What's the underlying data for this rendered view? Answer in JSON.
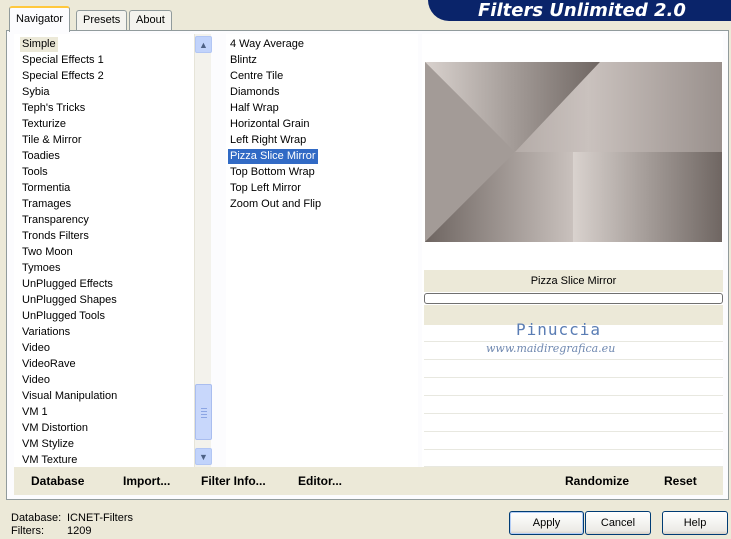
{
  "tabs": [
    {
      "label": "Navigator",
      "active": true
    },
    {
      "label": "Presets",
      "active": false
    },
    {
      "label": "About",
      "active": false
    }
  ],
  "banner": {
    "title": "Filters Unlimited 2.0"
  },
  "categories": {
    "selected": "Simple",
    "items": [
      "Simple",
      "Special Effects 1",
      "Special Effects 2",
      "Sybia",
      "Teph's Tricks",
      "Texturize",
      "Tile & Mirror",
      "Toadies",
      "Tools",
      "Tormentia",
      "Tramages",
      "Transparency",
      "Tronds Filters",
      "Two Moon",
      "Tymoes",
      "UnPlugged Effects",
      "UnPlugged Shapes",
      "UnPlugged Tools",
      "Variations",
      "Video",
      "VideoRave",
      "Video",
      "Visual Manipulation",
      "VM 1",
      "VM Distortion",
      "VM Stylize",
      "VM Texture"
    ]
  },
  "filters": {
    "selected": "Pizza Slice Mirror",
    "items": [
      "4 Way Average",
      "Blintz",
      "Centre Tile",
      "Diamonds",
      "Half Wrap",
      "Horizontal Grain",
      "Left Right Wrap",
      "Pizza Slice Mirror",
      "Top Bottom Wrap",
      "Top Left Mirror",
      "Zoom Out and Flip"
    ]
  },
  "preview": {
    "filter_name": "Pizza Slice Mirror"
  },
  "watermark": {
    "name": "Pinuccia",
    "site": "www.maidiregrafica.eu"
  },
  "bottom_links": {
    "database": "Database",
    "import": "Import...",
    "filter_info": "Filter Info...",
    "editor": "Editor...",
    "randomize": "Randomize",
    "reset": "Reset"
  },
  "status": {
    "database_label": "Database:",
    "database_value": "ICNET-Filters",
    "filters_label": "Filters:",
    "filters_value": "1209"
  },
  "buttons": {
    "apply": "Apply",
    "cancel": "Cancel",
    "help": "Help"
  },
  "colors": {
    "selection": "#316ac5",
    "banner": "#0a246a",
    "face": "#ece9d8"
  }
}
